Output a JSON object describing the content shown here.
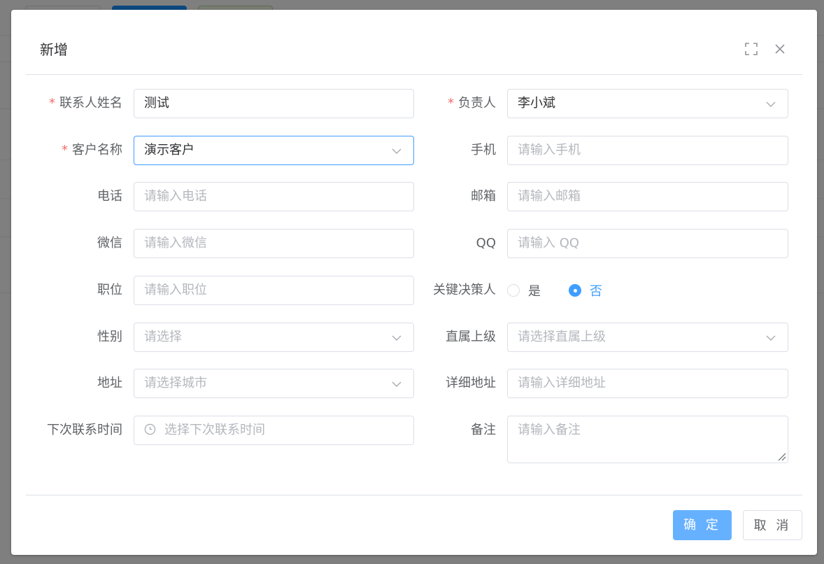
{
  "dialog": {
    "title": "新增",
    "icons": {
      "maximize": "fullscreen-icon",
      "close": "close-icon"
    }
  },
  "form": {
    "contact_name": {
      "label": "联系人姓名",
      "required": true,
      "value": "测试"
    },
    "owner": {
      "label": "负责人",
      "required": true,
      "value": "李小斌"
    },
    "customer_name": {
      "label": "客户名称",
      "required": true,
      "value": "演示客户"
    },
    "mobile": {
      "label": "手机",
      "placeholder": "请输入手机"
    },
    "phone": {
      "label": "电话",
      "placeholder": "请输入电话"
    },
    "email": {
      "label": "邮箱",
      "placeholder": "请输入邮箱"
    },
    "wechat": {
      "label": "微信",
      "placeholder": "请输入微信"
    },
    "qq": {
      "label": "QQ",
      "placeholder": "请输入 QQ"
    },
    "position": {
      "label": "职位",
      "placeholder": "请输入职位"
    },
    "key_decision_maker": {
      "label": "关键决策人",
      "options": [
        "是",
        "否"
      ],
      "selected": "否"
    },
    "gender": {
      "label": "性别",
      "placeholder": "请选择"
    },
    "superior": {
      "label": "直属上级",
      "placeholder": "请选择直属上级"
    },
    "address": {
      "label": "地址",
      "placeholder": "请选择城市"
    },
    "detail_address": {
      "label": "详细地址",
      "placeholder": "请输入详细地址"
    },
    "next_contact_time": {
      "label": "下次联系时间",
      "placeholder": "选择下次联系时间"
    },
    "remark": {
      "label": "备注",
      "placeholder": "请输入备注"
    }
  },
  "footer": {
    "confirm_label": "确 定",
    "cancel_label": "取 消"
  },
  "colors": {
    "primary": "#409eff",
    "required": "#f56c6c",
    "confirm_bg": "#66b1ff"
  }
}
